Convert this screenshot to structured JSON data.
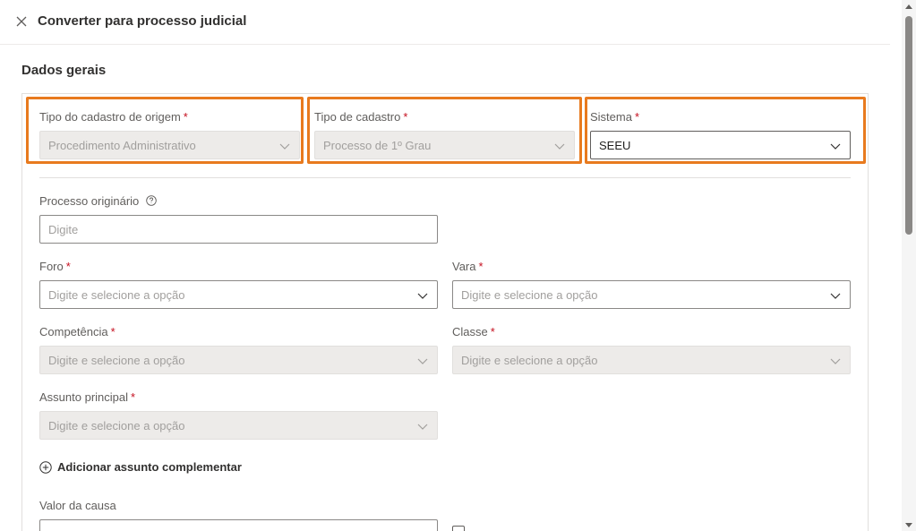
{
  "panel": {
    "title": "Converter para processo judicial",
    "close_icon": "close-icon"
  },
  "section": {
    "title": "Dados gerais"
  },
  "colors": {
    "highlight": "#e87a1e",
    "required": "#c50f1f"
  },
  "fields": {
    "tipo_cadastro_origem": {
      "label": "Tipo do cadastro de origem",
      "required": "*",
      "value": "Procedimento Administrativo"
    },
    "tipo_cadastro": {
      "label": "Tipo de cadastro",
      "required": "*",
      "value": "Processo de 1º Grau"
    },
    "sistema": {
      "label": "Sistema",
      "required": "*",
      "value": "SEEU"
    },
    "processo_originario": {
      "label": "Processo originário",
      "placeholder": "Digite"
    },
    "foro": {
      "label": "Foro",
      "required": "*",
      "placeholder": "Digite e selecione a opção"
    },
    "vara": {
      "label": "Vara",
      "required": "*",
      "placeholder": "Digite e selecione a opção"
    },
    "competencia": {
      "label": "Competência",
      "required": "*",
      "placeholder": "Digite e selecione a opção"
    },
    "classe": {
      "label": "Classe",
      "required": "*",
      "placeholder": "Digite e selecione a opção"
    },
    "assunto_principal": {
      "label": "Assunto principal",
      "required": "*",
      "placeholder": "Digite e selecione a opção"
    },
    "valor_causa": {
      "label": "Valor da causa"
    }
  },
  "actions": {
    "add_assunto": "Adicionar assunto complementar"
  }
}
